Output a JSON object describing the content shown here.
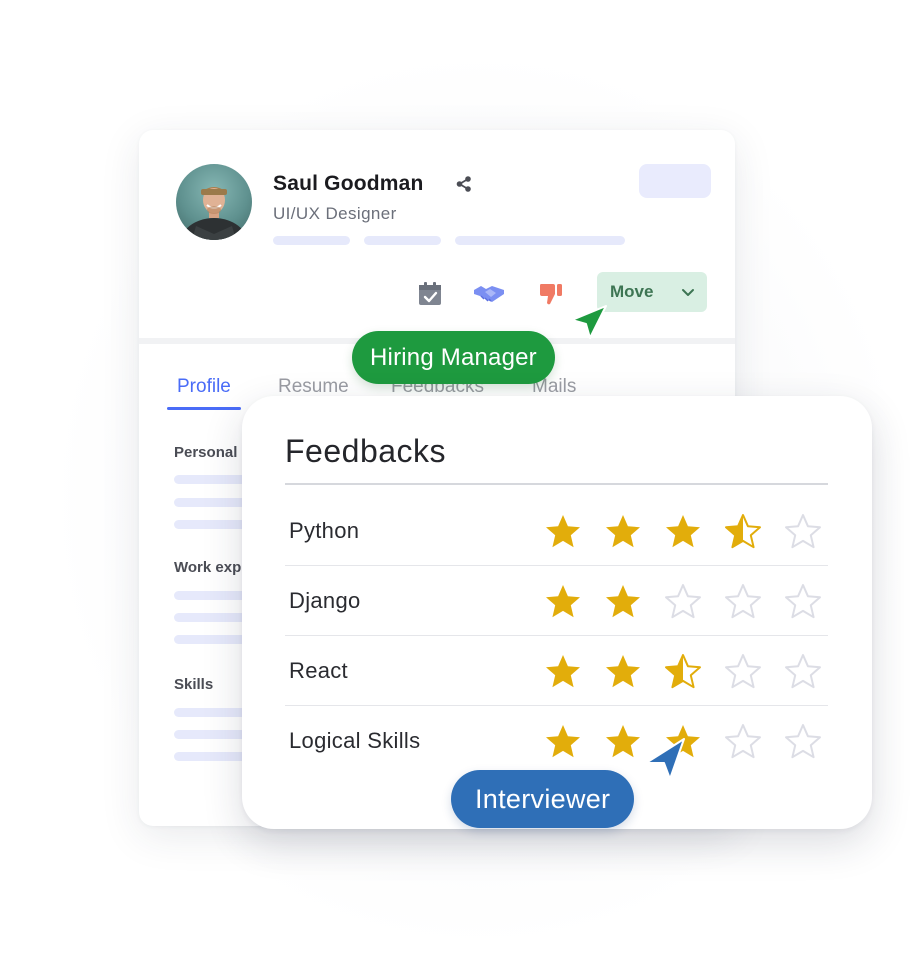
{
  "candidate": {
    "name": "Saul Goodman",
    "role": "UI/UX Designer",
    "share_icon": "share-icon"
  },
  "actions": {
    "schedule_icon": "calendar-check-icon",
    "handshake_icon": "handshake-icon",
    "reject_icon": "thumbs-down-icon",
    "move_label": "Move",
    "move_icon": "chevron-down-icon"
  },
  "tabs": [
    {
      "label": "Profile",
      "active": true
    },
    {
      "label": "Resume",
      "active": false
    },
    {
      "label": "Feedbacks",
      "active": false
    },
    {
      "label": "Mails",
      "active": false
    }
  ],
  "sections": {
    "personal": "Personal",
    "work": "Work exp",
    "skills": "Skills"
  },
  "roles": {
    "hiring_manager": "Hiring Manager",
    "interviewer": "Interviewer"
  },
  "feedbacks": {
    "title": "Feedbacks",
    "max_rating": 5,
    "items": [
      {
        "skill": "Python",
        "rating": 3.5
      },
      {
        "skill": "Django",
        "rating": 2
      },
      {
        "skill": "React",
        "rating": 2.5
      },
      {
        "skill": "Logical Skills",
        "rating": 3
      }
    ]
  },
  "colors": {
    "accent": "#4a6cf7",
    "star": "#e2ad0b",
    "star_empty": "#dcdde5",
    "hiring_manager": "#1e9a3f",
    "interviewer": "#2f6fb7",
    "move_bg": "#d9efe3"
  }
}
